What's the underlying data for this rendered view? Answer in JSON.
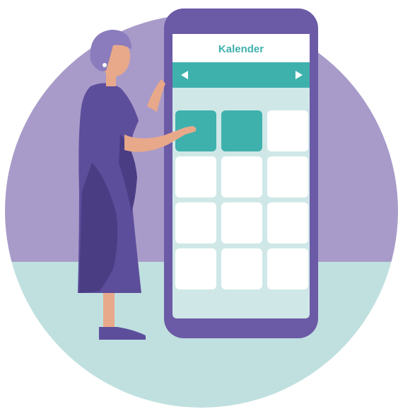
{
  "header": {
    "title": "Kalender"
  },
  "navigation": {
    "prev_icon": "triangle-left-icon",
    "next_icon": "triangle-right-icon"
  },
  "calendar": {
    "rows": 4,
    "columns": 3,
    "highlighted_cells": [
      0,
      1
    ]
  },
  "colors": {
    "background": "#ffffff",
    "circle_upper": "#a89bc9",
    "circle_lower": "#bfe0df",
    "phone_body": "#6b5aa6",
    "phone_screen": "#cfe8e7",
    "header_bar": "#ffffff",
    "nav_bar": "#3fb1ad",
    "cell_default": "#ffffff",
    "cell_highlight": "#3fb1ad",
    "accent_text": "#3fb1ad",
    "person_dress": "#5d4e9c",
    "person_dress_shade": "#4a3d84",
    "person_skin": "#e8a98a",
    "person_hair": "#8a7cbd"
  }
}
